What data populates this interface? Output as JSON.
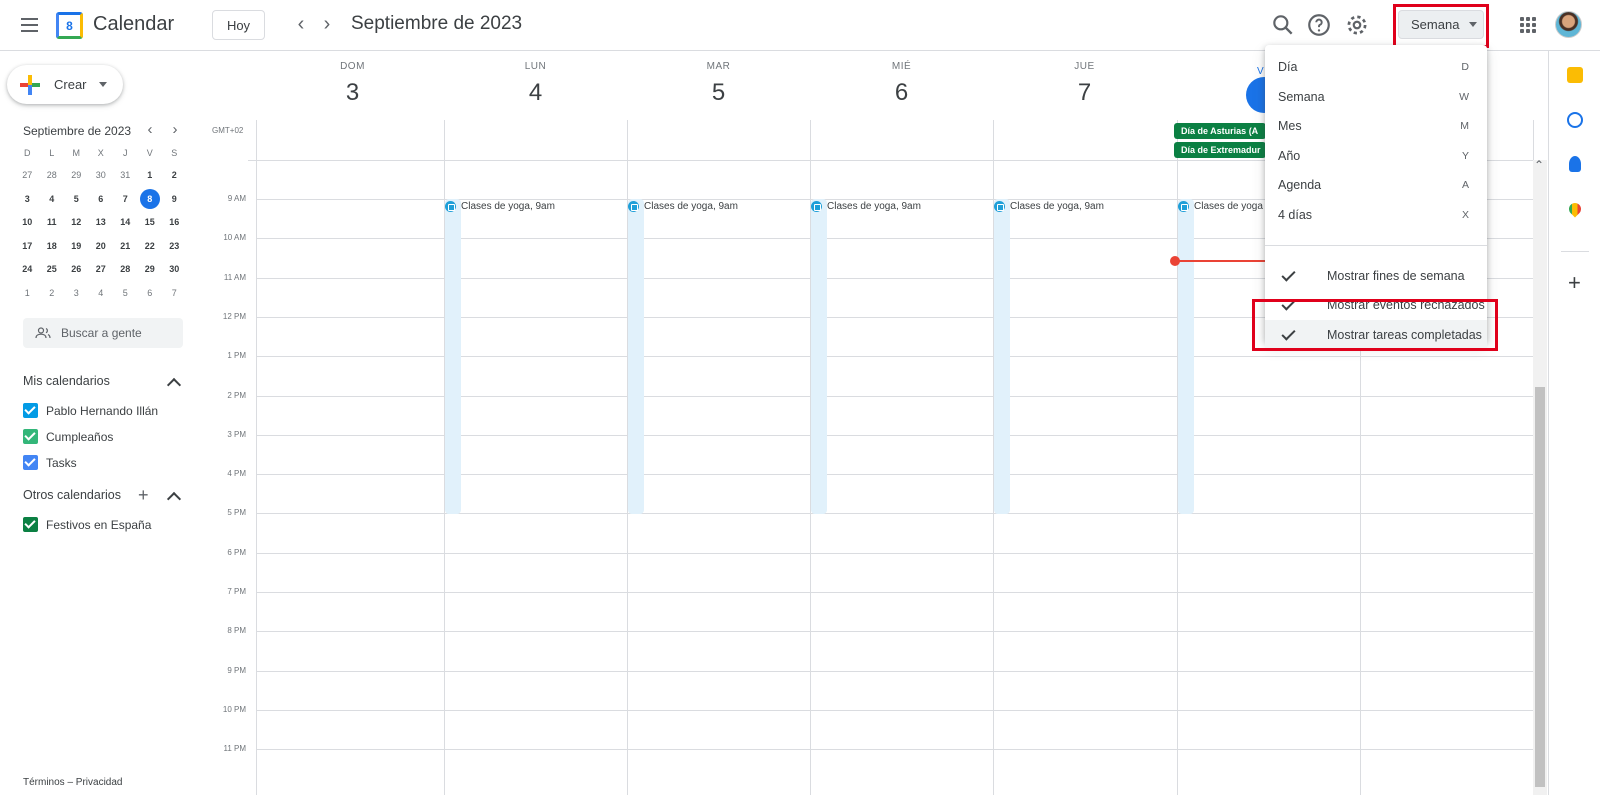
{
  "header": {
    "app_title": "Calendar",
    "logo_number": "8",
    "today_button": "Hoy",
    "prev_label": "‹",
    "next_label": "›",
    "period": "Septiembre de 2023",
    "view_button": "Semana",
    "icons": [
      "menu-icon",
      "search-icon",
      "help-icon",
      "settings-icon",
      "apps-icon",
      "avatar"
    ]
  },
  "sidebar": {
    "create_label": "Crear",
    "mini_calendar": {
      "title": "Septiembre de 2023",
      "weekdays": [
        "D",
        "L",
        "M",
        "X",
        "J",
        "V",
        "S"
      ],
      "weeks": [
        [
          "27",
          "28",
          "29",
          "30",
          "31",
          "1",
          "2"
        ],
        [
          "3",
          "4",
          "5",
          "6",
          "7",
          "8",
          "9"
        ],
        [
          "10",
          "11",
          "12",
          "13",
          "14",
          "15",
          "16"
        ],
        [
          "17",
          "18",
          "19",
          "20",
          "21",
          "22",
          "23"
        ],
        [
          "24",
          "25",
          "26",
          "27",
          "28",
          "29",
          "30"
        ],
        [
          "1",
          "2",
          "3",
          "4",
          "5",
          "6",
          "7"
        ]
      ],
      "selected_day": "8"
    },
    "search_people_placeholder": "Buscar a gente",
    "my_calendars_title": "Mis calendarios",
    "my_calendars": [
      {
        "name": "Pablo Hernando Illán",
        "color": "#039be5"
      },
      {
        "name": "Cumpleaños",
        "color": "#33b679"
      },
      {
        "name": "Tasks",
        "color": "#4285f4"
      }
    ],
    "other_calendars_title": "Otros calendarios",
    "other_calendars": [
      {
        "name": "Festivos en España",
        "color": "#0b8043"
      }
    ],
    "footer": "Términos – Privacidad"
  },
  "week": {
    "timezone": "GMT+02",
    "days": [
      {
        "dow": "DOM",
        "num": "3"
      },
      {
        "dow": "LUN",
        "num": "4"
      },
      {
        "dow": "MAR",
        "num": "5"
      },
      {
        "dow": "MIÉ",
        "num": "6"
      },
      {
        "dow": "JUE",
        "num": "7"
      },
      {
        "dow": "V",
        "num": "8"
      }
    ],
    "hours": [
      "9 AM",
      "10 AM",
      "11 AM",
      "12 PM",
      "1 PM",
      "2 PM",
      "3 PM",
      "4 PM",
      "5 PM",
      "6 PM",
      "7 PM",
      "8 PM",
      "9 PM",
      "10 PM",
      "11 PM"
    ],
    "event_title": "Clases de yoga",
    "event_time": ", 9am",
    "holidays": [
      "Día de Asturias (A",
      "Día de Extremadur"
    ]
  },
  "view_menu": {
    "items": [
      {
        "label": "Día",
        "key": "D"
      },
      {
        "label": "Semana",
        "key": "W"
      },
      {
        "label": "Mes",
        "key": "M"
      },
      {
        "label": "Año",
        "key": "Y"
      },
      {
        "label": "Agenda",
        "key": "A"
      },
      {
        "label": "4 días",
        "key": "X"
      }
    ],
    "options": [
      {
        "label": "Mostrar fines de semana",
        "checked": true
      },
      {
        "label": "Mostrar eventos rechazados",
        "checked": true
      },
      {
        "label": "Mostrar tareas completadas",
        "checked": true
      }
    ]
  },
  "colors": {
    "accent": "#1a73e8",
    "event_bg": "#e1f1fb",
    "holiday": "#0b8043",
    "now_line": "#ea4335",
    "highlight_box": "#e0001b"
  }
}
